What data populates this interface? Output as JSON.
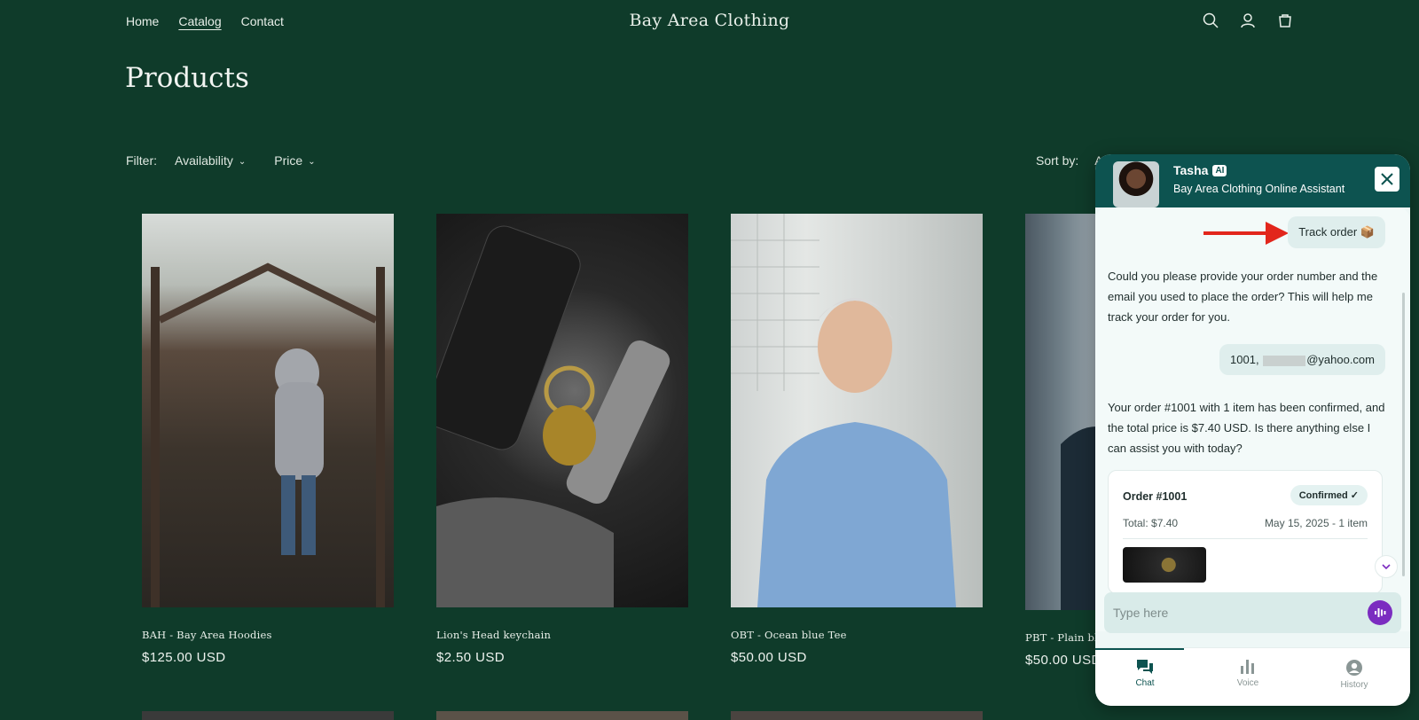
{
  "header": {
    "nav": [
      "Home",
      "Catalog",
      "Contact"
    ],
    "brand": "Bay Area Clothing"
  },
  "page": {
    "title": "Products"
  },
  "filters": {
    "label": "Filter:",
    "availability": "Availability",
    "price": "Price",
    "sort_label": "Sort by:",
    "sort_value": "A"
  },
  "products": [
    {
      "name": "BAH - Bay Area Hoodies",
      "price": "$125.00 USD"
    },
    {
      "name": "Lion's Head keychain",
      "price": "$2.50 USD"
    },
    {
      "name": "OBT - Ocean blue Tee",
      "price": "$50.00 USD"
    },
    {
      "name": "PBT - Plain bla",
      "price": "$50.00 USD"
    }
  ],
  "chat": {
    "agent_name": "Tasha",
    "ai_badge": "AI",
    "subtitle": "Bay Area Clothing Online Assistant",
    "messages": {
      "user1": "Track order 📦",
      "bot1": "Could you please provide your order number and the email you used to place the order? This will help me track your order for you.",
      "user2_prefix": "1001,",
      "user2_suffix": "@yahoo.com",
      "bot2": "Your order #1001 with 1 item has been confirmed, and the total price is $7.40 USD. Is there anything else I can assist you with today?"
    },
    "order": {
      "number": "Order #1001",
      "status": "Confirmed ✓",
      "total": "Total: $7.40",
      "date": "May 15, 2025 - 1 item"
    },
    "input_placeholder": "Type here",
    "tabs": [
      "Chat",
      "Voice",
      "History"
    ],
    "accent": "#0d5350",
    "mic_color": "#7b2cc0",
    "arrow_color": "#e2261c"
  }
}
